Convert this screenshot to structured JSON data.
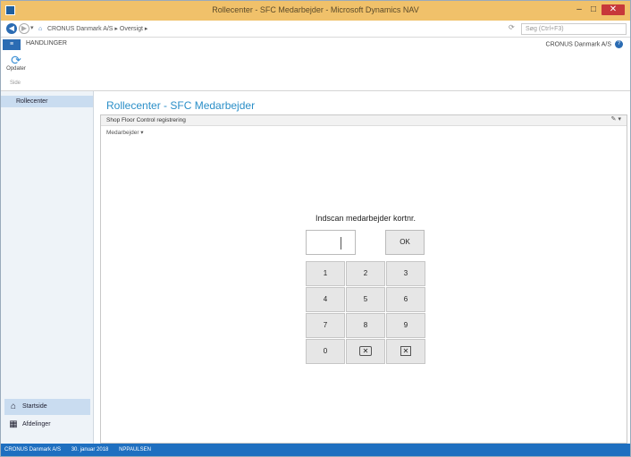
{
  "window": {
    "title": "Rollecenter - SFC Medarbejder - Microsoft Dynamics NAV",
    "minimize": "–",
    "maximize": "□",
    "close": "✕"
  },
  "address": {
    "back_icon": "back-arrow-icon",
    "forward_icon": "forward-arrow-icon",
    "breadcrumb": "CRONUS Danmark A/S ▸ Oversigt ▸",
    "search_placeholder": "Søg (Ctrl+F3)"
  },
  "ribbon": {
    "file_tab": "≡",
    "home_tab": "HANDLINGER",
    "company": "CRONUS Danmark A/S",
    "refresh_label": "Opdater",
    "group_label": "Side"
  },
  "nav": {
    "active_item": "Rollecenter",
    "bottom_buttons": [
      {
        "label": "Startside",
        "icon": "home-icon"
      },
      {
        "label": "Afdelinger",
        "icon": "departments-icon"
      }
    ]
  },
  "page": {
    "title": "Rollecenter - SFC Medarbejder",
    "part_title": "Shop Floor Control registrering",
    "part_subtitle": "Medarbejder ▾",
    "part_tools": "✎ ▾"
  },
  "numpad": {
    "title": "Indscan medarbejder kortnr.",
    "input_value": "",
    "ok_label": "OK",
    "keys": [
      "1",
      "2",
      "3",
      "4",
      "5",
      "6",
      "7",
      "8",
      "9",
      "0"
    ]
  },
  "statusbar": {
    "company": "CRONUS Danmark A/S",
    "date": "30. januar 2018",
    "user": "NPPAULSEN"
  }
}
